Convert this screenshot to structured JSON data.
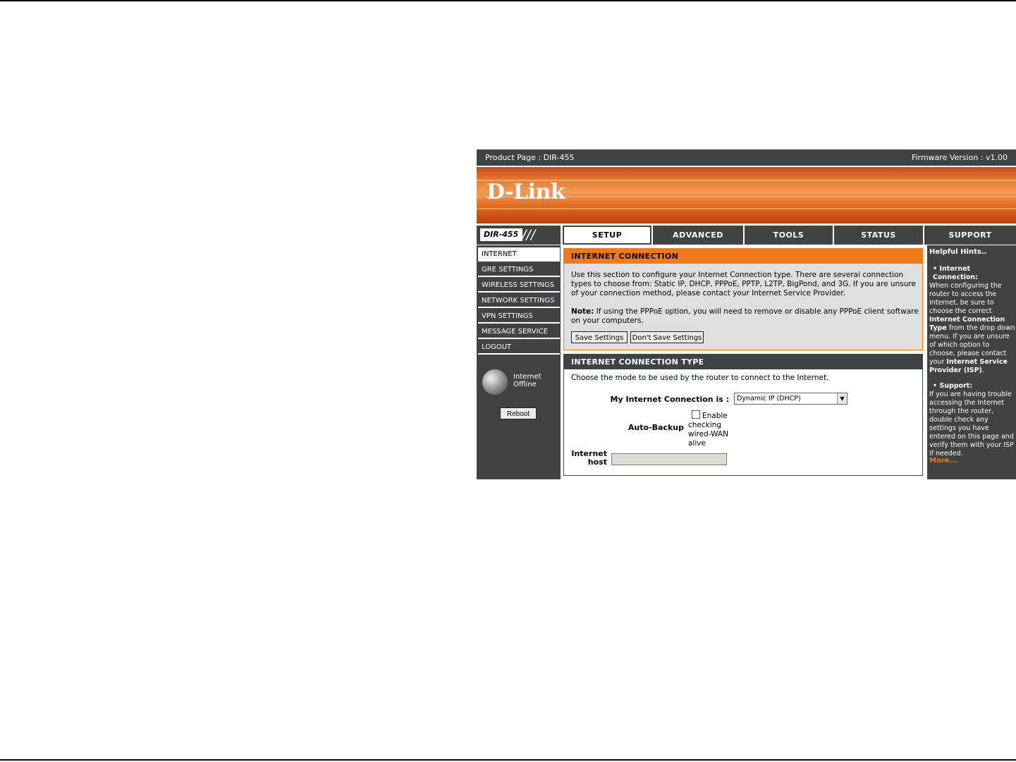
{
  "topbar": {
    "product_page": "Product Page :  DIR-455",
    "firmware": "Firmware Version : v1.00"
  },
  "banner": {
    "logo": "D-Link"
  },
  "model": {
    "label": "DIR-455",
    "slashes": "///"
  },
  "tabs": [
    "SETUP",
    "ADVANCED",
    "TOOLS",
    "STATUS",
    "SUPPORT"
  ],
  "sidebar": {
    "items": [
      "INTERNET",
      "GRE SETTINGS",
      "WIRELESS SETTINGS",
      "NETWORK SETTINGS",
      "VPN SETTINGS",
      "MESSAGE SERVICE",
      "LOGOUT"
    ],
    "status_line1": "Internet",
    "status_line2": "Offline",
    "reboot": "Reboot"
  },
  "internet_connection": {
    "header": "INTERNET CONNECTION",
    "intro": "Use this section to configure your Internet Connection type. There are several connection types to choose from: Static IP, DHCP, PPPoE, PPTP, L2TP, BigPond, and 3G. If you are unsure of your connection method, please contact your Internet Service Provider.",
    "note_label": "Note:",
    "note_text": " If using the PPPoE option, you will need to remove or disable any PPPoE client software on your computers.",
    "save_button": "Save Settings",
    "dont_save_button": "Don't Save Settings"
  },
  "connection_type": {
    "header": "INTERNET CONNECTION TYPE",
    "description": "Choose the mode to be used by the router to connect to the Internet.",
    "my_connection_label": "My Internet Connection is :",
    "selected": "Dynamic IP (DHCP)",
    "auto_backup_label": "Auto-Backup",
    "enable_text": "Enable checking wired-WAN alive",
    "internet_host_label_1": "Internet",
    "internet_host_label_2": "host",
    "internet_host_value": ""
  },
  "hints": {
    "title": "Helpful Hints..",
    "s1_head": "• Internet Connection:",
    "s1_a": "When configuring the router to access the Internet, be sure to choose the correct ",
    "s1_b": "Internet Connection Type",
    "s1_c": " from the drop down menu. If you are unsure of which option to choose, please contact your ",
    "s1_d": "Internet Service Provider (ISP)",
    "s1_e": ".",
    "s2_head": "• Support:",
    "s2_text": "If you are having trouble accessing the Internet through the router, double check any settings you have entered on this page and verify them with your ISP if needed.",
    "more": "More..."
  }
}
